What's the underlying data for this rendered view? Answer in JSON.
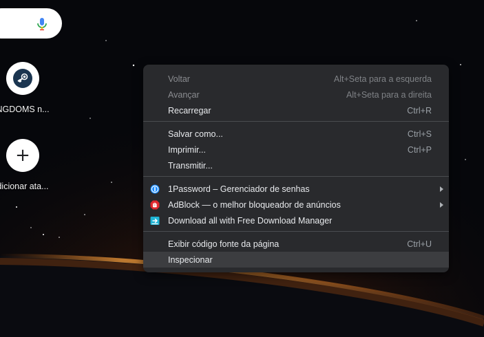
{
  "new_tab": {
    "shortcuts": [
      {
        "label": "NGDOMS n...",
        "icon": "steam-icon"
      },
      {
        "label": "dicionar ata...",
        "icon": "plus-icon"
      }
    ]
  },
  "context_menu": {
    "groups": [
      [
        {
          "label": "Voltar",
          "shortcut": "Alt+Seta para a esquerda",
          "disabled": true
        },
        {
          "label": "Avançar",
          "shortcut": "Alt+Seta para a direita",
          "disabled": true
        },
        {
          "label": "Recarregar",
          "shortcut": "Ctrl+R",
          "disabled": false
        }
      ],
      [
        {
          "label": "Salvar como...",
          "shortcut": "Ctrl+S"
        },
        {
          "label": "Imprimir...",
          "shortcut": "Ctrl+P"
        },
        {
          "label": "Transmitir..."
        }
      ],
      [
        {
          "label": "1Password – Gerenciador de senhas",
          "icon": "1password-icon",
          "submenu": true
        },
        {
          "label": "AdBlock — o melhor bloqueador de anúncios",
          "icon": "adblock-icon",
          "submenu": true
        },
        {
          "label": "Download all with Free Download Manager",
          "icon": "fdm-icon"
        }
      ],
      [
        {
          "label": "Exibir código fonte da página",
          "shortcut": "Ctrl+U"
        },
        {
          "label": "Inspecionar",
          "highlighted": true
        }
      ]
    ]
  },
  "colors": {
    "menu_bg": "#292a2d",
    "menu_highlight": "#3c3d40",
    "menu_text": "#e8eaed",
    "menu_disabled_text": "#8a8c90"
  }
}
